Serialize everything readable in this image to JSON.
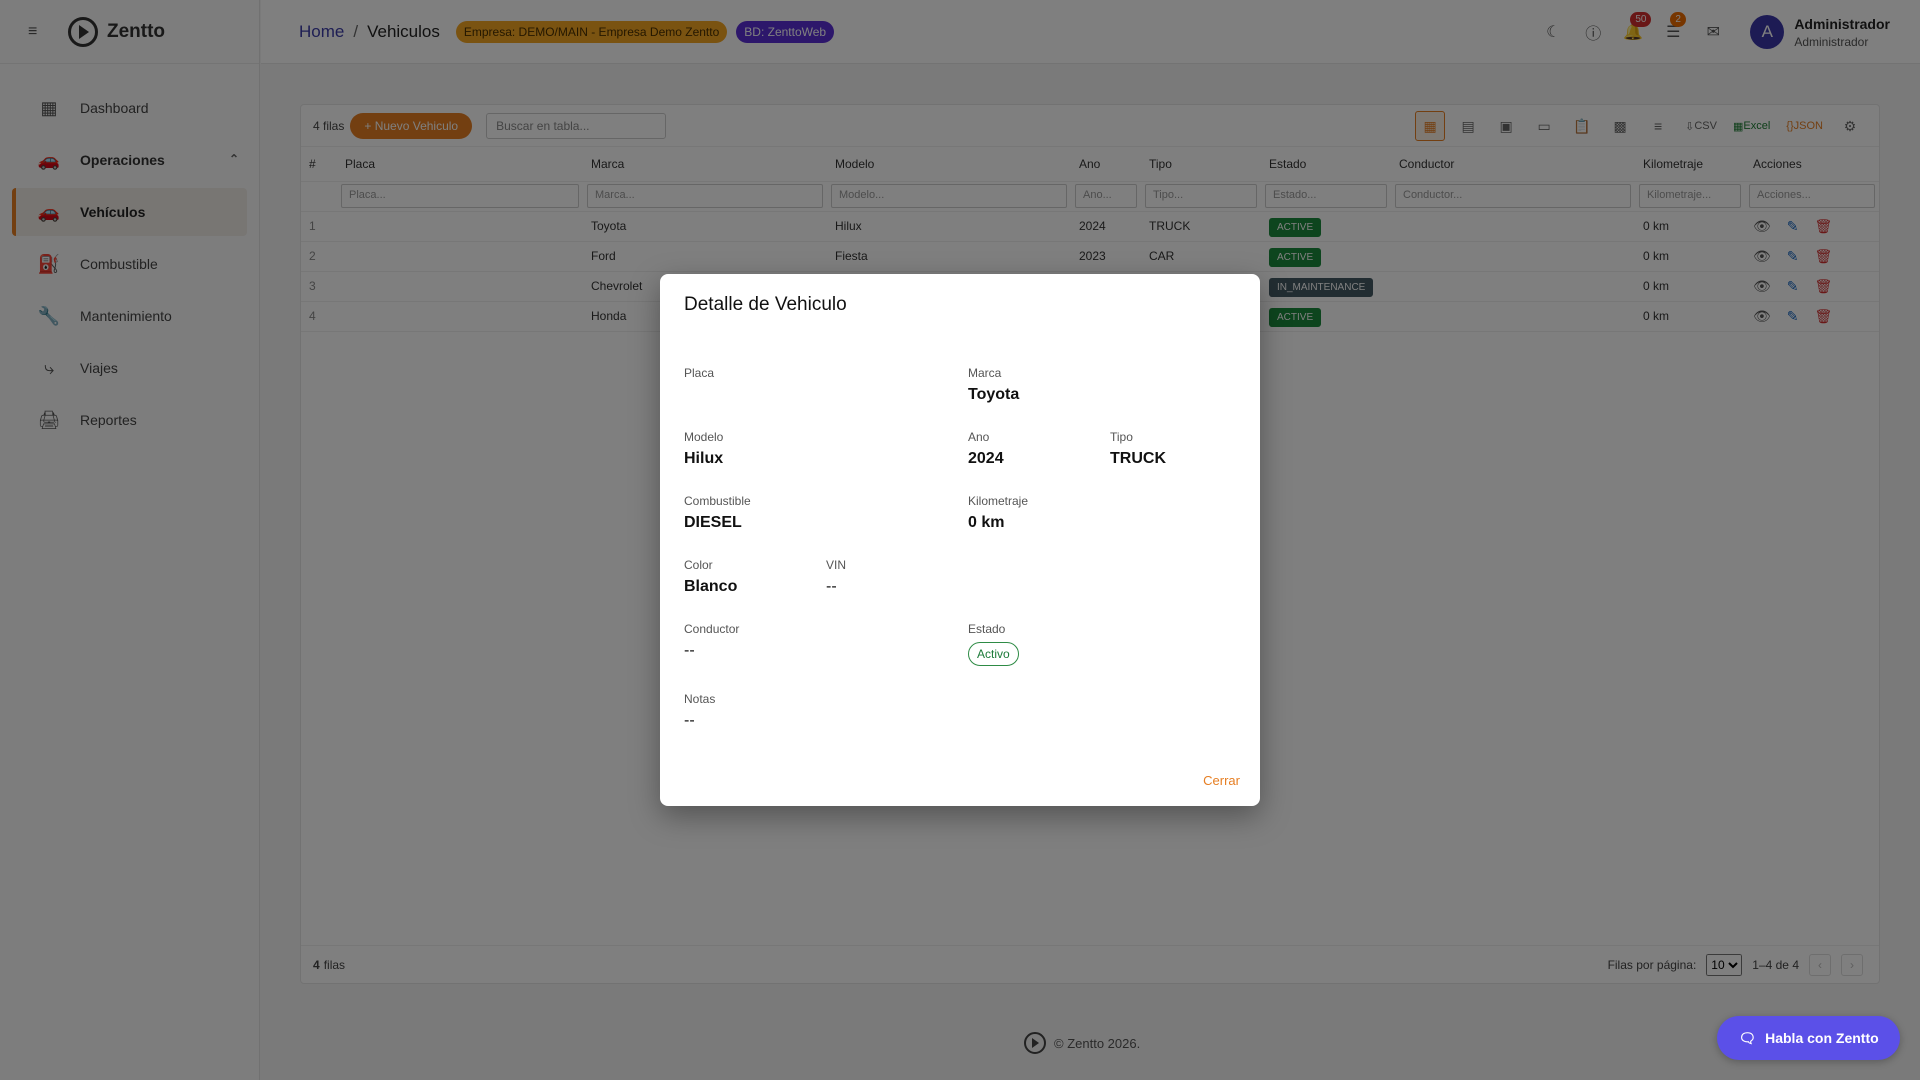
{
  "app": {
    "name": "Zentto"
  },
  "sidebar": {
    "items": [
      {
        "label": "Dashboard",
        "icon": "dashboard-icon"
      },
      {
        "label": "Operaciones",
        "icon": "car-icon"
      },
      {
        "label": "Vehículos",
        "icon": "car-icon"
      },
      {
        "label": "Combustible",
        "icon": "fuel-icon"
      },
      {
        "label": "Mantenimiento",
        "icon": "wrench-icon"
      },
      {
        "label": "Viajes",
        "icon": "route-icon"
      },
      {
        "label": "Reportes",
        "icon": "printer-icon"
      }
    ]
  },
  "header": {
    "breadcrumb_home": "Home",
    "breadcrumb_sep": "/",
    "breadcrumb_current": "Vehiculos",
    "empresa_chip": "Empresa: DEMO/MAIN - Empresa Demo Zentto",
    "bd_chip": "BD: ZenttoWeb",
    "notifications_count": "50",
    "tasks_count": "2",
    "avatar_letter": "A",
    "user_name": "Administrador",
    "user_role": "Administrador"
  },
  "toolbar": {
    "row_count": "4 filas",
    "new_button": "Nuevo Vehiculo",
    "search_placeholder": "Buscar en tabla...",
    "csv_label": "CSV",
    "excel_label": "Excel",
    "json_label": "JSON"
  },
  "table": {
    "headers": [
      "#",
      "Placa",
      "Marca",
      "Modelo",
      "Ano",
      "Tipo",
      "Estado",
      "Conductor",
      "Kilometraje",
      "Acciones"
    ],
    "filters": [
      "Placa...",
      "Marca...",
      "Modelo...",
      "Ano...",
      "Tipo...",
      "Estado...",
      "Conductor...",
      "Kilometraje...",
      "Acciones..."
    ],
    "rows": [
      {
        "num": "1",
        "placa": "",
        "marca": "Toyota",
        "modelo": "Hilux",
        "ano": "2024",
        "tipo": "TRUCK",
        "estado": "ACTIVE",
        "conductor": "",
        "km": "0 km"
      },
      {
        "num": "2",
        "placa": "",
        "marca": "Ford",
        "modelo": "Fiesta",
        "ano": "2023",
        "tipo": "CAR",
        "estado": "ACTIVE",
        "conductor": "",
        "km": "0 km"
      },
      {
        "num": "3",
        "placa": "",
        "marca": "Chevrolet",
        "modelo": "",
        "ano": "",
        "tipo": "",
        "estado": "IN_MAINTENANCE",
        "conductor": "",
        "km": "0 km"
      },
      {
        "num": "4",
        "placa": "",
        "marca": "Honda",
        "modelo": "",
        "ano": "",
        "tipo": "",
        "estado": "ACTIVE",
        "conductor": "",
        "km": "0 km"
      }
    ]
  },
  "footer_bar": {
    "rows_bold": "4",
    "rows_label": "filas",
    "per_page_label": "Filas por página:",
    "per_page_value": "10",
    "range": "1–4 de 4"
  },
  "site_footer": {
    "copyright": "© Zentto 2026."
  },
  "chat_button": {
    "label": "Habla con Zentto"
  },
  "modal": {
    "title": "Detalle de Vehiculo",
    "placa_label": "Placa",
    "placa_value": "",
    "marca_label": "Marca",
    "marca_value": "Toyota",
    "modelo_label": "Modelo",
    "modelo_value": "Hilux",
    "ano_label": "Ano",
    "ano_value": "2024",
    "tipo_label": "Tipo",
    "tipo_value": "TRUCK",
    "combustible_label": "Combustible",
    "combustible_value": "DIESEL",
    "km_label": "Kilometraje",
    "km_value": "0 km",
    "color_label": "Color",
    "color_value": "Blanco",
    "vin_label": "VIN",
    "vin_value": "--",
    "conductor_label": "Conductor",
    "conductor_value": "--",
    "estado_label": "Estado",
    "estado_value": "Activo",
    "notas_label": "Notas",
    "notas_value": "--",
    "close_button": "Cerrar"
  },
  "colors": {
    "accent": "#e67e22",
    "primary": "#3a36a8",
    "active_status": "#1b8a3c",
    "maintenance_status": "#455a64",
    "chat": "#5b50e8"
  }
}
